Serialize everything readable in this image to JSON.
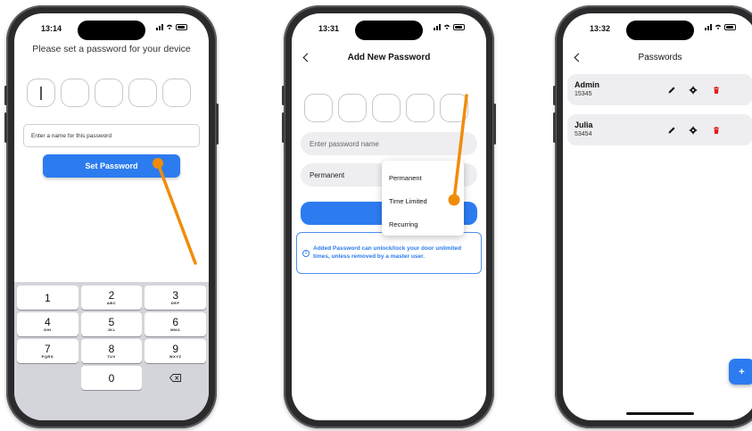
{
  "colors": {
    "accent": "#2c7cf0",
    "pointer": "#f08c0a",
    "delete": "#e02020"
  },
  "phone1": {
    "time": "13:14",
    "title": "Please set a password for your device",
    "pin_cursor": "|",
    "name_input_placeholder": "Enter a name for this password",
    "set_button": "Set Password",
    "keys": [
      {
        "num": "1",
        "letters": ""
      },
      {
        "num": "2",
        "letters": "ABC"
      },
      {
        "num": "3",
        "letters": "DEF"
      },
      {
        "num": "4",
        "letters": "GHI"
      },
      {
        "num": "5",
        "letters": "JKL"
      },
      {
        "num": "6",
        "letters": "MNO"
      },
      {
        "num": "7",
        "letters": "PQRS"
      },
      {
        "num": "8",
        "letters": "TUV"
      },
      {
        "num": "9",
        "letters": "WXYZ"
      },
      {
        "num": "0",
        "letters": ""
      }
    ]
  },
  "phone2": {
    "time": "13:31",
    "title": "Add New Password",
    "name_placeholder": "Enter password name",
    "type_value": "Permanent",
    "confirm_partial": "Co",
    "dropdown_options": [
      "Permanent",
      "Time Limited",
      "Recurring"
    ],
    "info_icon": "i",
    "info_text": "Added Password can unlock/lock your door unlimited times, unless removed by a master user."
  },
  "phone3": {
    "time": "13:32",
    "title": "Passwords",
    "entries": [
      {
        "name": "Admin",
        "code": "15345"
      },
      {
        "name": "Julia",
        "code": "53454"
      }
    ],
    "fab": "+"
  }
}
